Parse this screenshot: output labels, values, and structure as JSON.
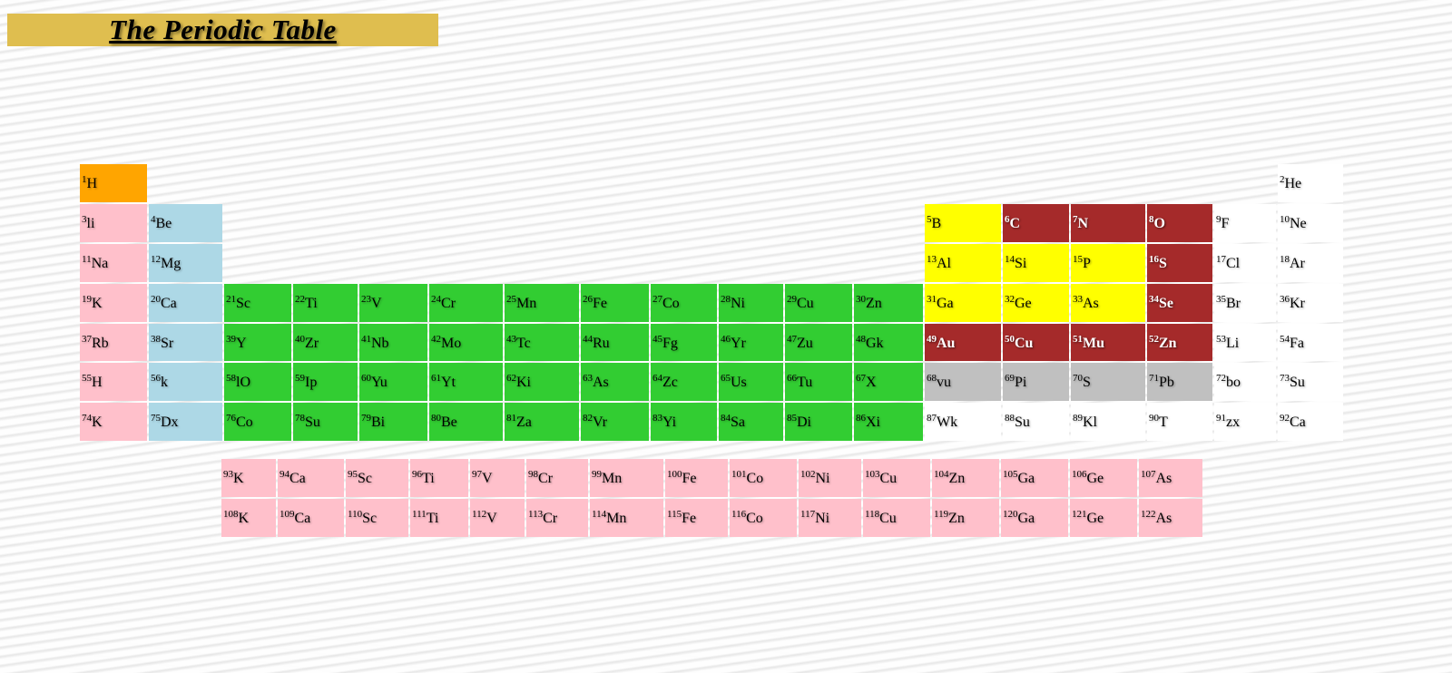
{
  "page": {
    "title": "The Periodic Table"
  },
  "colors": {
    "orange": "#ffa500",
    "pink": "#ffc0cb",
    "blue": "#add8e6",
    "green": "#32cd32",
    "yellow": "#ffff00",
    "red": "#a52a2a",
    "gray": "#c0c0c0",
    "white": "#ffffff",
    "banner": "#dfbe4f"
  },
  "main_table": [
    [
      "1|H|orange",
      "",
      "",
      "",
      "",
      "",
      "",
      "",
      "",
      "",
      "",
      "",
      "",
      "",
      "",
      "",
      "",
      "2|He|white"
    ],
    [
      "3|li|pink",
      "4|Be|blue",
      "",
      "",
      "",
      "",
      "",
      "",
      "",
      "",
      "",
      "",
      "5|B|yellow",
      "6|C|red",
      "7|N|red",
      "8|O|red",
      "9|F|white",
      "10|Ne|white"
    ],
    [
      "11|Na|pink",
      "12|Mg|blue",
      "",
      "",
      "",
      "",
      "",
      "",
      "",
      "",
      "",
      "",
      "13|Al|yellow",
      "14|Si|yellow",
      "15|P|yellow",
      "16|S|red",
      "17|Cl|white",
      "18|Ar|white"
    ],
    [
      "19|K|pink",
      "20|Ca|blue",
      "21|Sc|green",
      "22|Ti|green",
      "23|V|green",
      "24|Cr|green",
      "25|Mn|green",
      "26|Fe|green",
      "27|Co|green",
      "28|Ni|green",
      "29|Cu|green",
      "30|Zn|green",
      "31|Ga|yellow",
      "32|Ge|yellow",
      "33|As|yellow",
      "34|Se|red",
      "35|Br|white",
      "36|Kr|white"
    ],
    [
      "37|Rb|pink",
      "38|Sr|blue",
      "39|Y|green",
      "40|Zr|green",
      "41|Nb|green",
      "42|Mo|green",
      "43|Tc|green",
      "44|Ru|green",
      "45|Fg|green",
      "46|Yr|green",
      "47|Zu|green",
      "48|Gk|green",
      "49|Au|red",
      "50|Cu|red",
      "51|Mu|red",
      "52|Zn|red",
      "53|Li|white",
      "54|Fa|white"
    ],
    [
      "55|H|pink",
      "56|k|blue",
      "58|lO|green",
      "59|Ip|green",
      "60|Yu|green",
      "61|Yt|green",
      "62|Ki|green",
      "63|As|green",
      "64|Zc|green",
      "65|Us|green",
      "66|Tu|green",
      "67|X|green",
      "68|vu|gray",
      "69|Pi|gray",
      "70|S|gray",
      "71|Pb|gray",
      "72|bo|white",
      "73|Su|white"
    ],
    [
      "74|K|pink",
      "75|Dx|blue",
      "76|Co|green",
      "78|Su|green",
      "79|Bi|green",
      "80|Be|green",
      "81|Za|green",
      "82|Vr|green",
      "83|Yi|green",
      "84|Sa|green",
      "85|Di|green",
      "86|Xi|green",
      "87|Wk|white",
      "88|Su|white",
      "89|Kl|white",
      "90|T|white",
      "91|zx|white",
      "92|Ca|white"
    ]
  ],
  "sub_table": [
    [
      "93|K|pink",
      "94|Ca|pink",
      "95|Sc|pink",
      "96|Ti|pink",
      "97|V|pink",
      "98|Cr|pink",
      "99|Mn|pink",
      "100|Fe|pink",
      "101|Co|pink",
      "102|Ni|pink",
      "103|Cu|pink",
      "104|Zn|pink",
      "105|Ga|pink",
      "106|Ge|pink",
      "107|As|pink"
    ],
    [
      "108|K|pink",
      "109|Ca|pink",
      "110|Sc|pink",
      "111|Ti|pink",
      "112|V|pink",
      "113|Cr|pink",
      "114|Mn|pink",
      "115|Fe|pink",
      "116|Co|pink",
      "117|Ni|pink",
      "118|Cu|pink",
      "119|Zn|pink",
      "120|Ga|pink",
      "121|Ge|pink",
      "122|As|pink"
    ]
  ]
}
